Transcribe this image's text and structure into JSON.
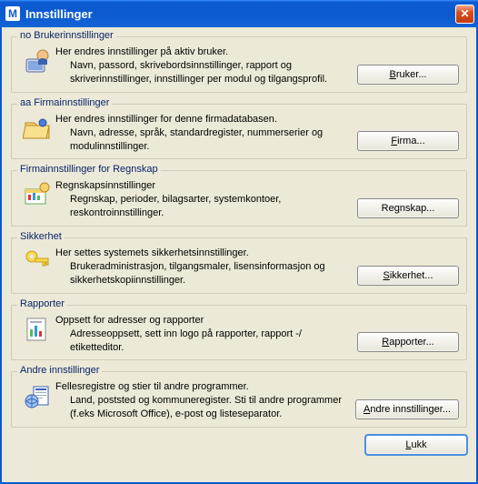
{
  "window": {
    "title": "Innstillinger"
  },
  "groups": {
    "g0": {
      "label": "no Brukerinnstillinger",
      "heading": "Her endres innstillinger på aktiv bruker.",
      "desc": "Navn, passord, skrivebordsinnstillinger, rapport og skriverinnstillinger, innstillinger per modul og tilgangsprofil.",
      "button": "Bruker...",
      "button_ul": "B"
    },
    "g1": {
      "label": "aa Firmainnstillinger",
      "heading": "Her endres innstillinger for denne firmadatabasen.",
      "desc": "Navn, adresse, språk, standardregister, nummerserier og modulinnstillinger.",
      "button": "Firma...",
      "button_ul": "F"
    },
    "g2": {
      "label": "Firmainnstillinger for Regnskap",
      "heading": "Regnskapsinnstillinger",
      "desc": "Regnskap, perioder, bilagsarter, systemkontoer, reskontroinnstillinger.",
      "button": "Regnskap...",
      "button_ul": "g"
    },
    "g3": {
      "label": "Sikkerhet",
      "heading": "Her settes systemets sikkerhetsinnstillinger.",
      "desc": "Brukeradministrasjon, tilgangsmaler, lisensinformasjon og sikkerhetskopiinnstillinger.",
      "button": "Sikkerhet...",
      "button_ul": "S"
    },
    "g4": {
      "label": "Rapporter",
      "heading": "Oppsett for adresser og rapporter",
      "desc": "Adresseoppsett, sett inn logo på rapporter, rapport -/ etiketteditor.",
      "button": "Rapporter...",
      "button_ul": "R"
    },
    "g5": {
      "label": "Andre innstillinger",
      "heading": "Fellesregistre og stier til andre programmer.",
      "desc": "Land, poststed og kommuneregister. Sti til andre programmer (f.eks Microsoft Office), e-post og listeseparator.",
      "button": "Andre innstillinger...",
      "button_ul": "A"
    }
  },
  "footer": {
    "close": "Lukk",
    "close_ul": "L"
  }
}
